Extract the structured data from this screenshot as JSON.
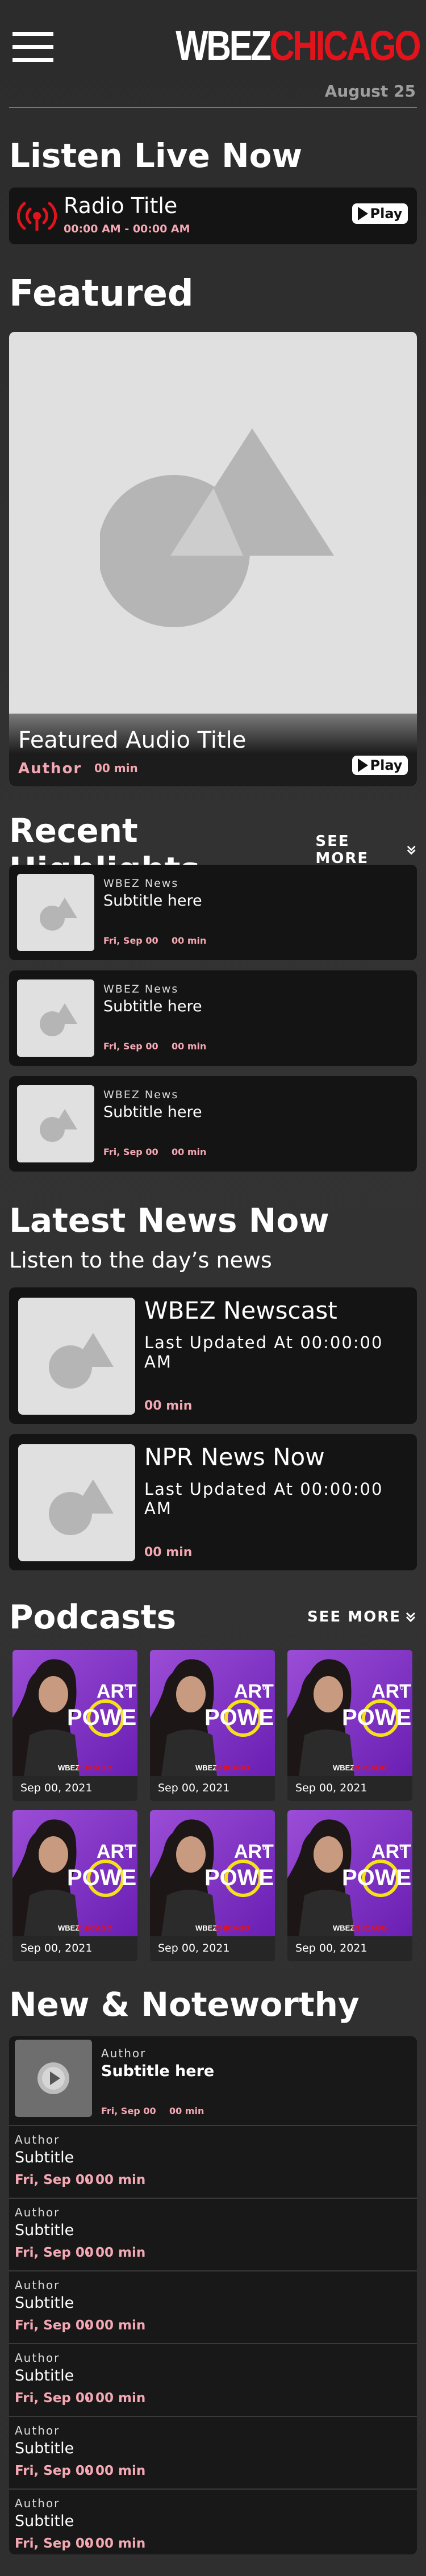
{
  "header": {
    "logo_left": "WBEZ",
    "logo_right": "CHICAGO",
    "date": "August 25"
  },
  "colors": {
    "accent_pink": "#f4a8b4",
    "brand_red": "#e3131c",
    "placeholder_gray": "#e0e0e0"
  },
  "listen_live": {
    "heading": "Listen Live Now",
    "radio_title": "Radio Title",
    "time": "00:00 AM - 00:00 AM",
    "play_label": "Play"
  },
  "featured": {
    "heading": "Featured",
    "title": "Featured Audio Title",
    "author": "Author",
    "duration": "00 min",
    "play_label": "Play"
  },
  "highlights": {
    "heading": "Recent Highlights",
    "see_more": "SEE MORE",
    "items": [
      {
        "source": "WBEZ News",
        "subtitle": "Subtitle here",
        "date": "Fri, Sep 00",
        "duration": "00 min"
      },
      {
        "source": "WBEZ News",
        "subtitle": "Subtitle here",
        "date": "Fri, Sep 00",
        "duration": "00 min"
      },
      {
        "source": "WBEZ News",
        "subtitle": "Subtitle here",
        "date": "Fri, Sep 00",
        "duration": "00 min"
      }
    ]
  },
  "latest_news": {
    "heading": "Latest News Now",
    "subheading": "Listen to the day’s news",
    "items": [
      {
        "title": "WBEZ Newscast",
        "updated": "Last Updated At 00:00:00 AM",
        "duration": "00 min"
      },
      {
        "title": "NPR News Now",
        "updated": "Last Updated At 00:00:00 AM",
        "duration": "00 min"
      }
    ]
  },
  "podcasts": {
    "heading": "Podcasts",
    "see_more": "SEE MORE",
    "art_text": {
      "line1": "ART",
      "of": "of",
      "line2": "POWER",
      "brand_left": "WBEZ",
      "brand_right": "CHICAGO"
    },
    "items": [
      {
        "date": "Sep 00, 2021"
      },
      {
        "date": "Sep 00, 2021"
      },
      {
        "date": "Sep 00, 2021"
      },
      {
        "date": "Sep 00, 2021"
      },
      {
        "date": "Sep 00, 2021"
      },
      {
        "date": "Sep 00, 2021"
      }
    ]
  },
  "noteworthy": {
    "heading": "New & Noteworthy",
    "first": {
      "author": "Author",
      "subtitle": "Subtitle here",
      "date": "Fri, Sep 00",
      "duration": "00 min"
    },
    "items": [
      {
        "author": "Author",
        "subtitle": "Subtitle",
        "date": "Fri, Sep 00",
        "duration": "00 min"
      },
      {
        "author": "Author",
        "subtitle": "Subtitle",
        "date": "Fri, Sep 00",
        "duration": "00 min"
      },
      {
        "author": "Author",
        "subtitle": "Subtitle",
        "date": "Fri, Sep 00",
        "duration": "00 min"
      },
      {
        "author": "Author",
        "subtitle": "Subtitle",
        "date": "Fri, Sep 00",
        "duration": "00 min"
      },
      {
        "author": "Author",
        "subtitle": "Subtitle",
        "date": "Fri, Sep 00",
        "duration": "00 min"
      },
      {
        "author": "Author",
        "subtitle": "Subtitle",
        "date": "Fri, Sep 00",
        "duration": "00 min"
      }
    ]
  }
}
